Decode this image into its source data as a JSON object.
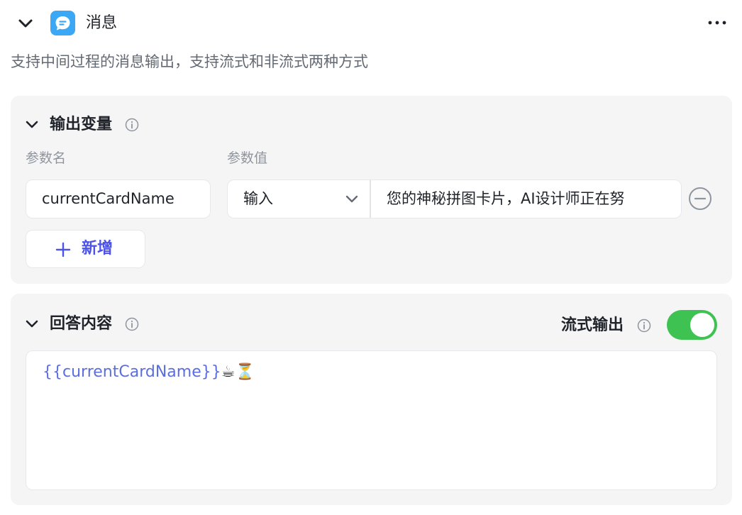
{
  "node": {
    "title": "消息",
    "description": "支持中间过程的消息输出，支持流式和非流式两种方式",
    "icon": "message-bubble-icon",
    "icon_color": "#3aa8f5"
  },
  "output_vars": {
    "title": "输出变量",
    "col_name_label": "参数名",
    "col_value_label": "参数值",
    "rows": [
      {
        "name": "currentCardName",
        "type": "输入",
        "value": "您的神秘拼图卡片，AI设计师正在努"
      }
    ],
    "add_label": "新增"
  },
  "answer": {
    "title": "回答内容",
    "stream_label": "流式输出",
    "stream_enabled": true,
    "content_template": "{{currentCardName}}",
    "content_emoji": "☕⏳"
  },
  "colors": {
    "accent": "#4d53e8",
    "toggle_on": "#3ec252",
    "template_var": "#5b6ee0"
  }
}
